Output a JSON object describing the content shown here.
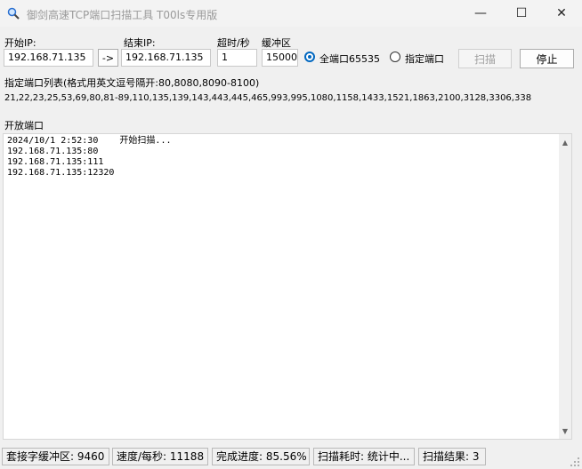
{
  "window": {
    "title": "御剑高速TCP端口扫描工具 T00ls专用版",
    "min_glyph": "—",
    "max_glyph": "☐",
    "close_glyph": "✕"
  },
  "form": {
    "start_ip_label": "开始IP:",
    "start_ip_value": "192.168.71.135",
    "copy_arrow_label": "->",
    "end_ip_label": "结束IP:",
    "end_ip_value": "192.168.71.135",
    "timeout_label": "超时/秒",
    "timeout_value": "1",
    "buffer_label": "缓冲区",
    "buffer_value": "15000",
    "all_ports_label": "全端口65535",
    "all_ports_selected": true,
    "specified_ports_label": "指定端口",
    "scan_button": "扫描",
    "stop_button": "停止"
  },
  "port_list": {
    "label": "指定端口列表(格式用英文逗号隔开:80,8080,8090-8100)",
    "value": "21,22,23,25,53,69,80,81-89,110,135,139,143,443,445,465,993,995,1080,1158,1433,1521,1863,2100,3128,3306,338"
  },
  "open_ports": {
    "label": "开放端口",
    "log": "2024/10/1 2:52:30    开始扫描...\n192.168.71.135:80\n192.168.71.135:111\n192.168.71.135:12320"
  },
  "status": {
    "buffer": "套接字缓冲区: 9460",
    "speed": "速度/每秒: 11188",
    "progress": "完成进度: 85.56%",
    "elapsed": "扫描耗时: 统计中...",
    "results": "扫描结果: 3"
  },
  "icons": {
    "app": "magnifier-icon",
    "scroll_up": "scroll-up-arrow-icon",
    "scroll_down": "scroll-down-arrow-icon",
    "resize": "resize-grip-icon"
  }
}
